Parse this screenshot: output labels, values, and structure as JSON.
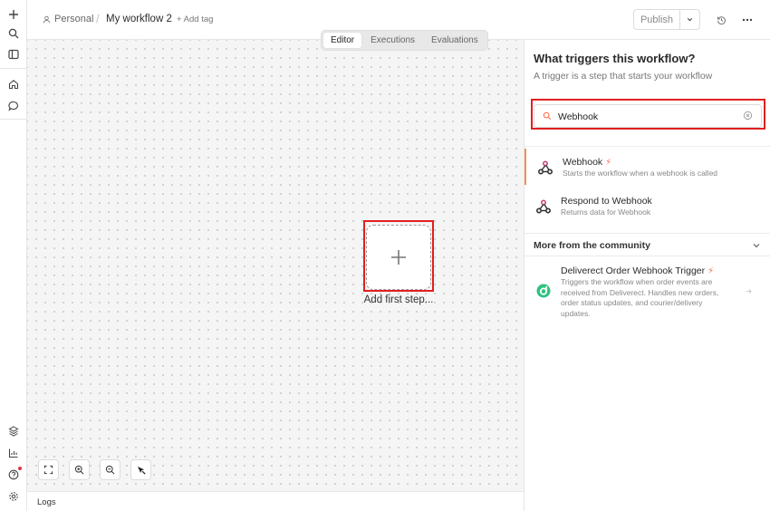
{
  "header": {
    "project": "Personal",
    "workflow_name": "My workflow 2",
    "add_tag": "+ Add tag",
    "publish_label": "Publish"
  },
  "canvas": {
    "tabs": [
      {
        "label": "Editor",
        "active": true
      },
      {
        "label": "Executions",
        "active": false
      },
      {
        "label": "Evaluations",
        "active": false
      }
    ],
    "add_first_step": "Add first step..."
  },
  "logs": {
    "label": "Logs"
  },
  "panel": {
    "title": "What triggers this workflow?",
    "subtitle": "A trigger is a step that starts your workflow",
    "search": {
      "value": "Webhook"
    },
    "results": [
      {
        "name": "Webhook",
        "description": "Starts the workflow when a webhook is called",
        "trigger": true
      },
      {
        "name": "Respond to Webhook",
        "description": "Returns data for Webhook",
        "trigger": false
      }
    ],
    "community_section": "More from the community",
    "community": [
      {
        "name": "Deliverect Order Webhook Trigger",
        "description_lines": [
          "Triggers the workflow when order events are",
          "received from Deliverect. Handles new orders,",
          "order status updates, and courier/delivery",
          "updates."
        ]
      }
    ]
  },
  "colors": {
    "accent": "#ff6d4a",
    "highlight": "#e02020",
    "deliverect": "#2ec27e",
    "webhook_pink": "#c4457a"
  }
}
